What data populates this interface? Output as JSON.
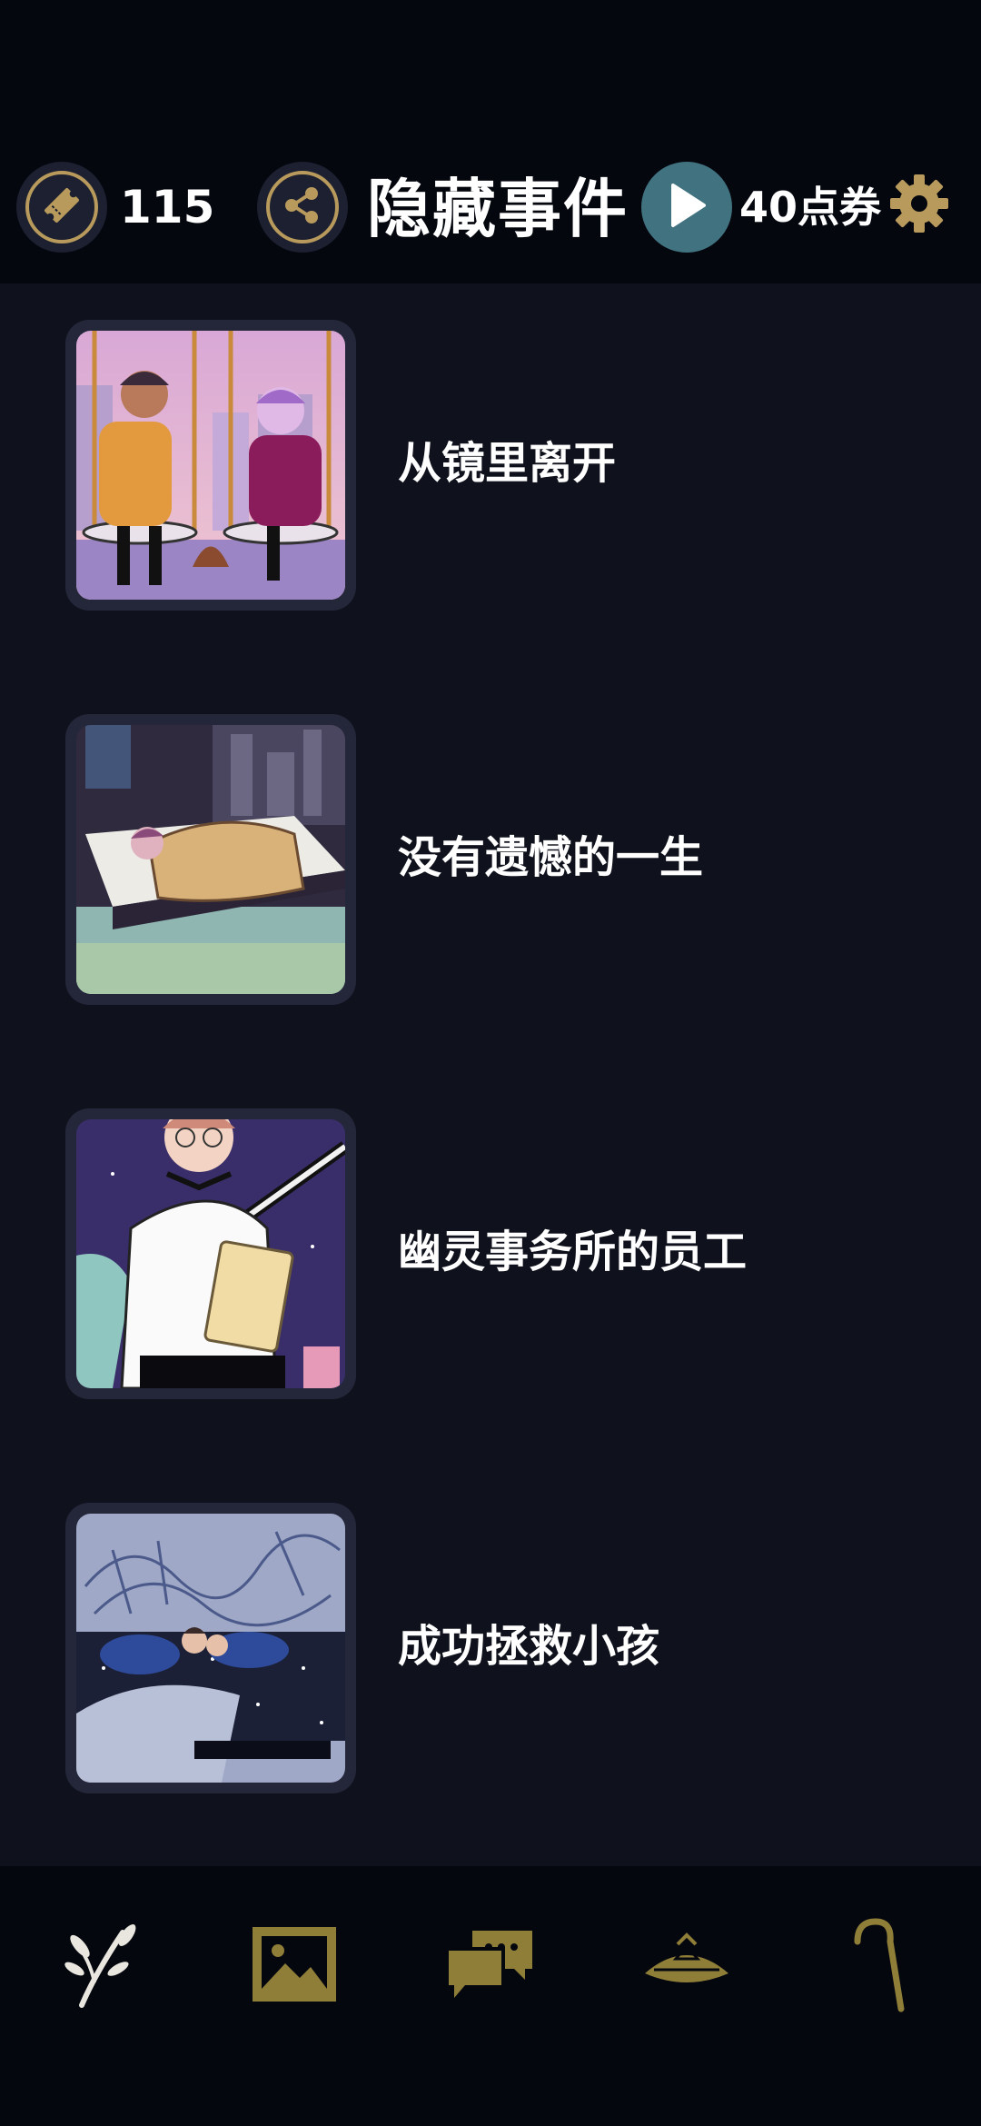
{
  "header": {
    "ticket_icon": "ticket-icon",
    "ticket_count": "115",
    "share_icon": "share-icon",
    "title": "隐藏事件",
    "play_icon": "play-icon",
    "coupon_text": "40点券",
    "settings_icon": "gear-icon"
  },
  "events": [
    {
      "label": "从镜里离开",
      "thumb": "couple-on-swings-illustration"
    },
    {
      "label": "没有遗憾的一生",
      "thumb": "person-sleeping-in-bed-illustration"
    },
    {
      "label": "幽灵事务所的员工",
      "thumb": "office-worker-with-notebook-illustration"
    },
    {
      "label": "成功拯救小孩",
      "thumb": "children-sleeping-illustration"
    }
  ],
  "bottom_nav": [
    {
      "icon": "branch-icon"
    },
    {
      "icon": "gallery-icon"
    },
    {
      "icon": "chat-icon"
    },
    {
      "icon": "hat-icon"
    },
    {
      "icon": "cane-icon"
    }
  ],
  "colors": {
    "gold": "#b89a5c",
    "nav_gold": "#8f7e38",
    "background": "#05070f",
    "list_background": "#0f121c",
    "play_button": "#41727f"
  }
}
